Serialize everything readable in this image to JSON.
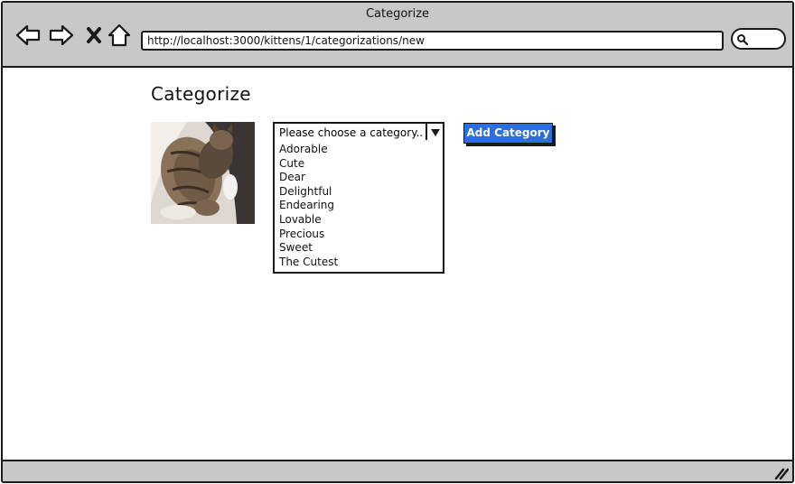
{
  "window": {
    "title": "Categorize",
    "address": "http://localhost:3000/kittens/1/categorizations/new"
  },
  "nav": {
    "icons": [
      "back-arrow-icon",
      "forward-arrow-icon",
      "close-x-icon",
      "home-icon"
    ]
  },
  "page": {
    "heading": "Categorize",
    "image_alt_icon": "cat-photo",
    "select": {
      "selected": "Please choose a category...",
      "options": [
        "Adorable",
        "Cute",
        "Dear",
        "Delightful",
        "Endearing",
        "Lovable",
        "Precious",
        "Sweet",
        "The Cutest"
      ]
    },
    "add_button_label": "Add Category"
  },
  "colors": {
    "chrome": "#c8c8c8",
    "button": "#2a6ee0",
    "border": "#1a1a1a"
  }
}
